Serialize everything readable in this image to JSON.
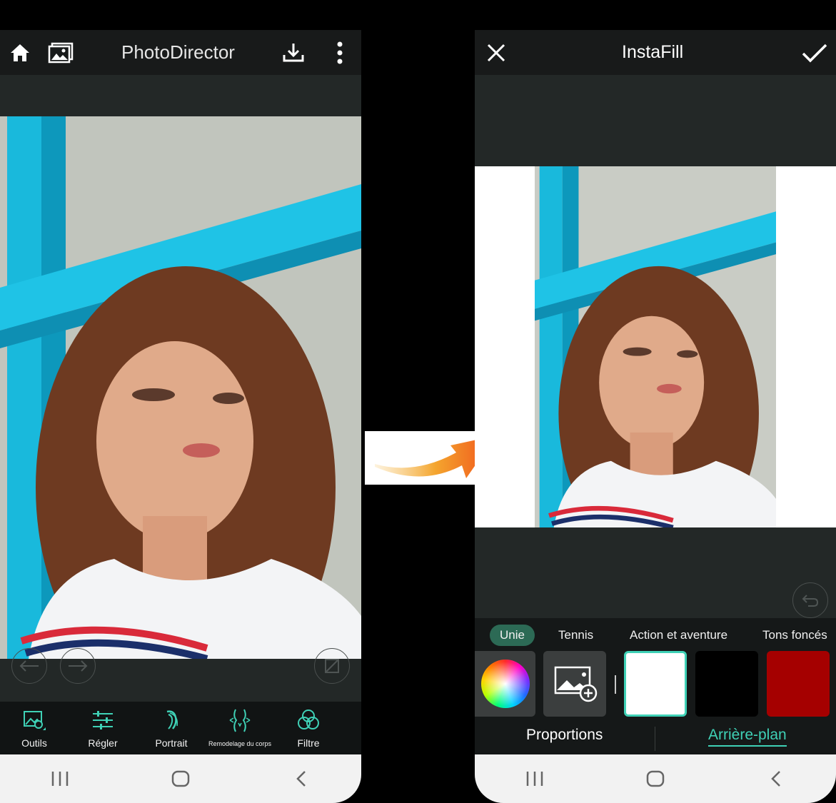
{
  "left_screen": {
    "app_title": "PhotoDirector",
    "toolbar": {
      "tools": [
        {
          "label": "Outils",
          "icon": "tools-image-icon"
        },
        {
          "label": "Régler",
          "icon": "sliders-icon"
        },
        {
          "label": "Portrait",
          "icon": "portrait-icon"
        },
        {
          "label": "Remodelage du corps",
          "icon": "body-reshape-icon"
        },
        {
          "label": "Filtre",
          "icon": "filter-icon"
        }
      ]
    }
  },
  "right_screen": {
    "title": "InstaFill",
    "background_tabs": [
      "Unie",
      "Tennis",
      "Action et aventure",
      "Tons foncés"
    ],
    "active_background_tab": "Unie",
    "swatch_colors": [
      "#ffffff",
      "#000000",
      "#a50000"
    ],
    "selected_swatch": "#ffffff",
    "bottom_tabs": {
      "proportions": "Proportions",
      "background": "Arrière-plan"
    },
    "active_bottom_tab": "Arrière-plan"
  },
  "colors": {
    "accent": "#3fd1b6",
    "active_pill": "#2c6a55",
    "arrow_start": "#f6b13a",
    "arrow_end": "#f0501a"
  }
}
